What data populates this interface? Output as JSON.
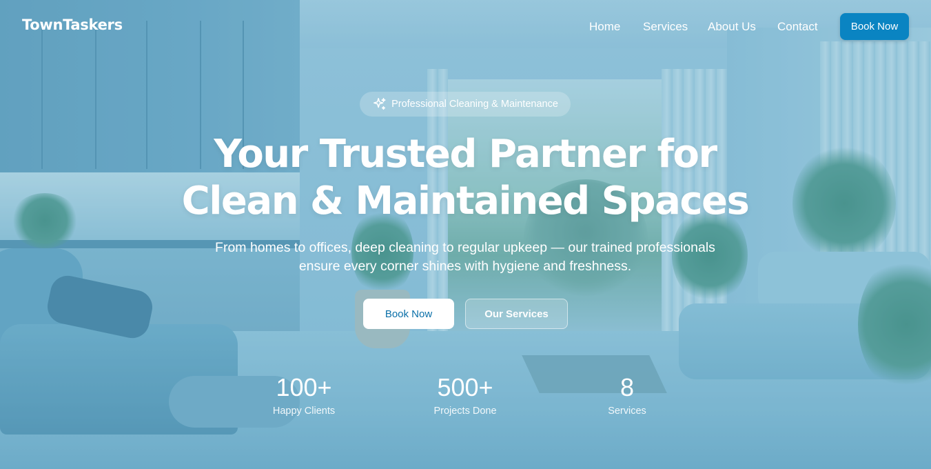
{
  "brand": {
    "name": "TownTaskers"
  },
  "nav": {
    "links": [
      "Home",
      "Services",
      "About Us",
      "Contact"
    ],
    "cta_label": "Book Now"
  },
  "hero": {
    "badge_text": "Professional Cleaning & Maintenance",
    "badge_icon": "sparkles-icon",
    "headline_line1": "Your Trusted Partner for",
    "headline_line2": "Clean & Maintained Spaces",
    "subtitle": "From homes to offices, deep cleaning to regular upkeep — our trained professionals ensure every corner shines with hygiene and freshness.",
    "primary_button": "Book Now",
    "secondary_button": "Our Services"
  },
  "stats": [
    {
      "value": "100+",
      "label": "Happy Clients"
    },
    {
      "value": "500+",
      "label": "Projects Done"
    },
    {
      "value": "8",
      "label": "Services"
    }
  ],
  "colors": {
    "accent": "#0a84c2",
    "primary_button_text": "#0a6fa8",
    "text": "#ffffff"
  }
}
